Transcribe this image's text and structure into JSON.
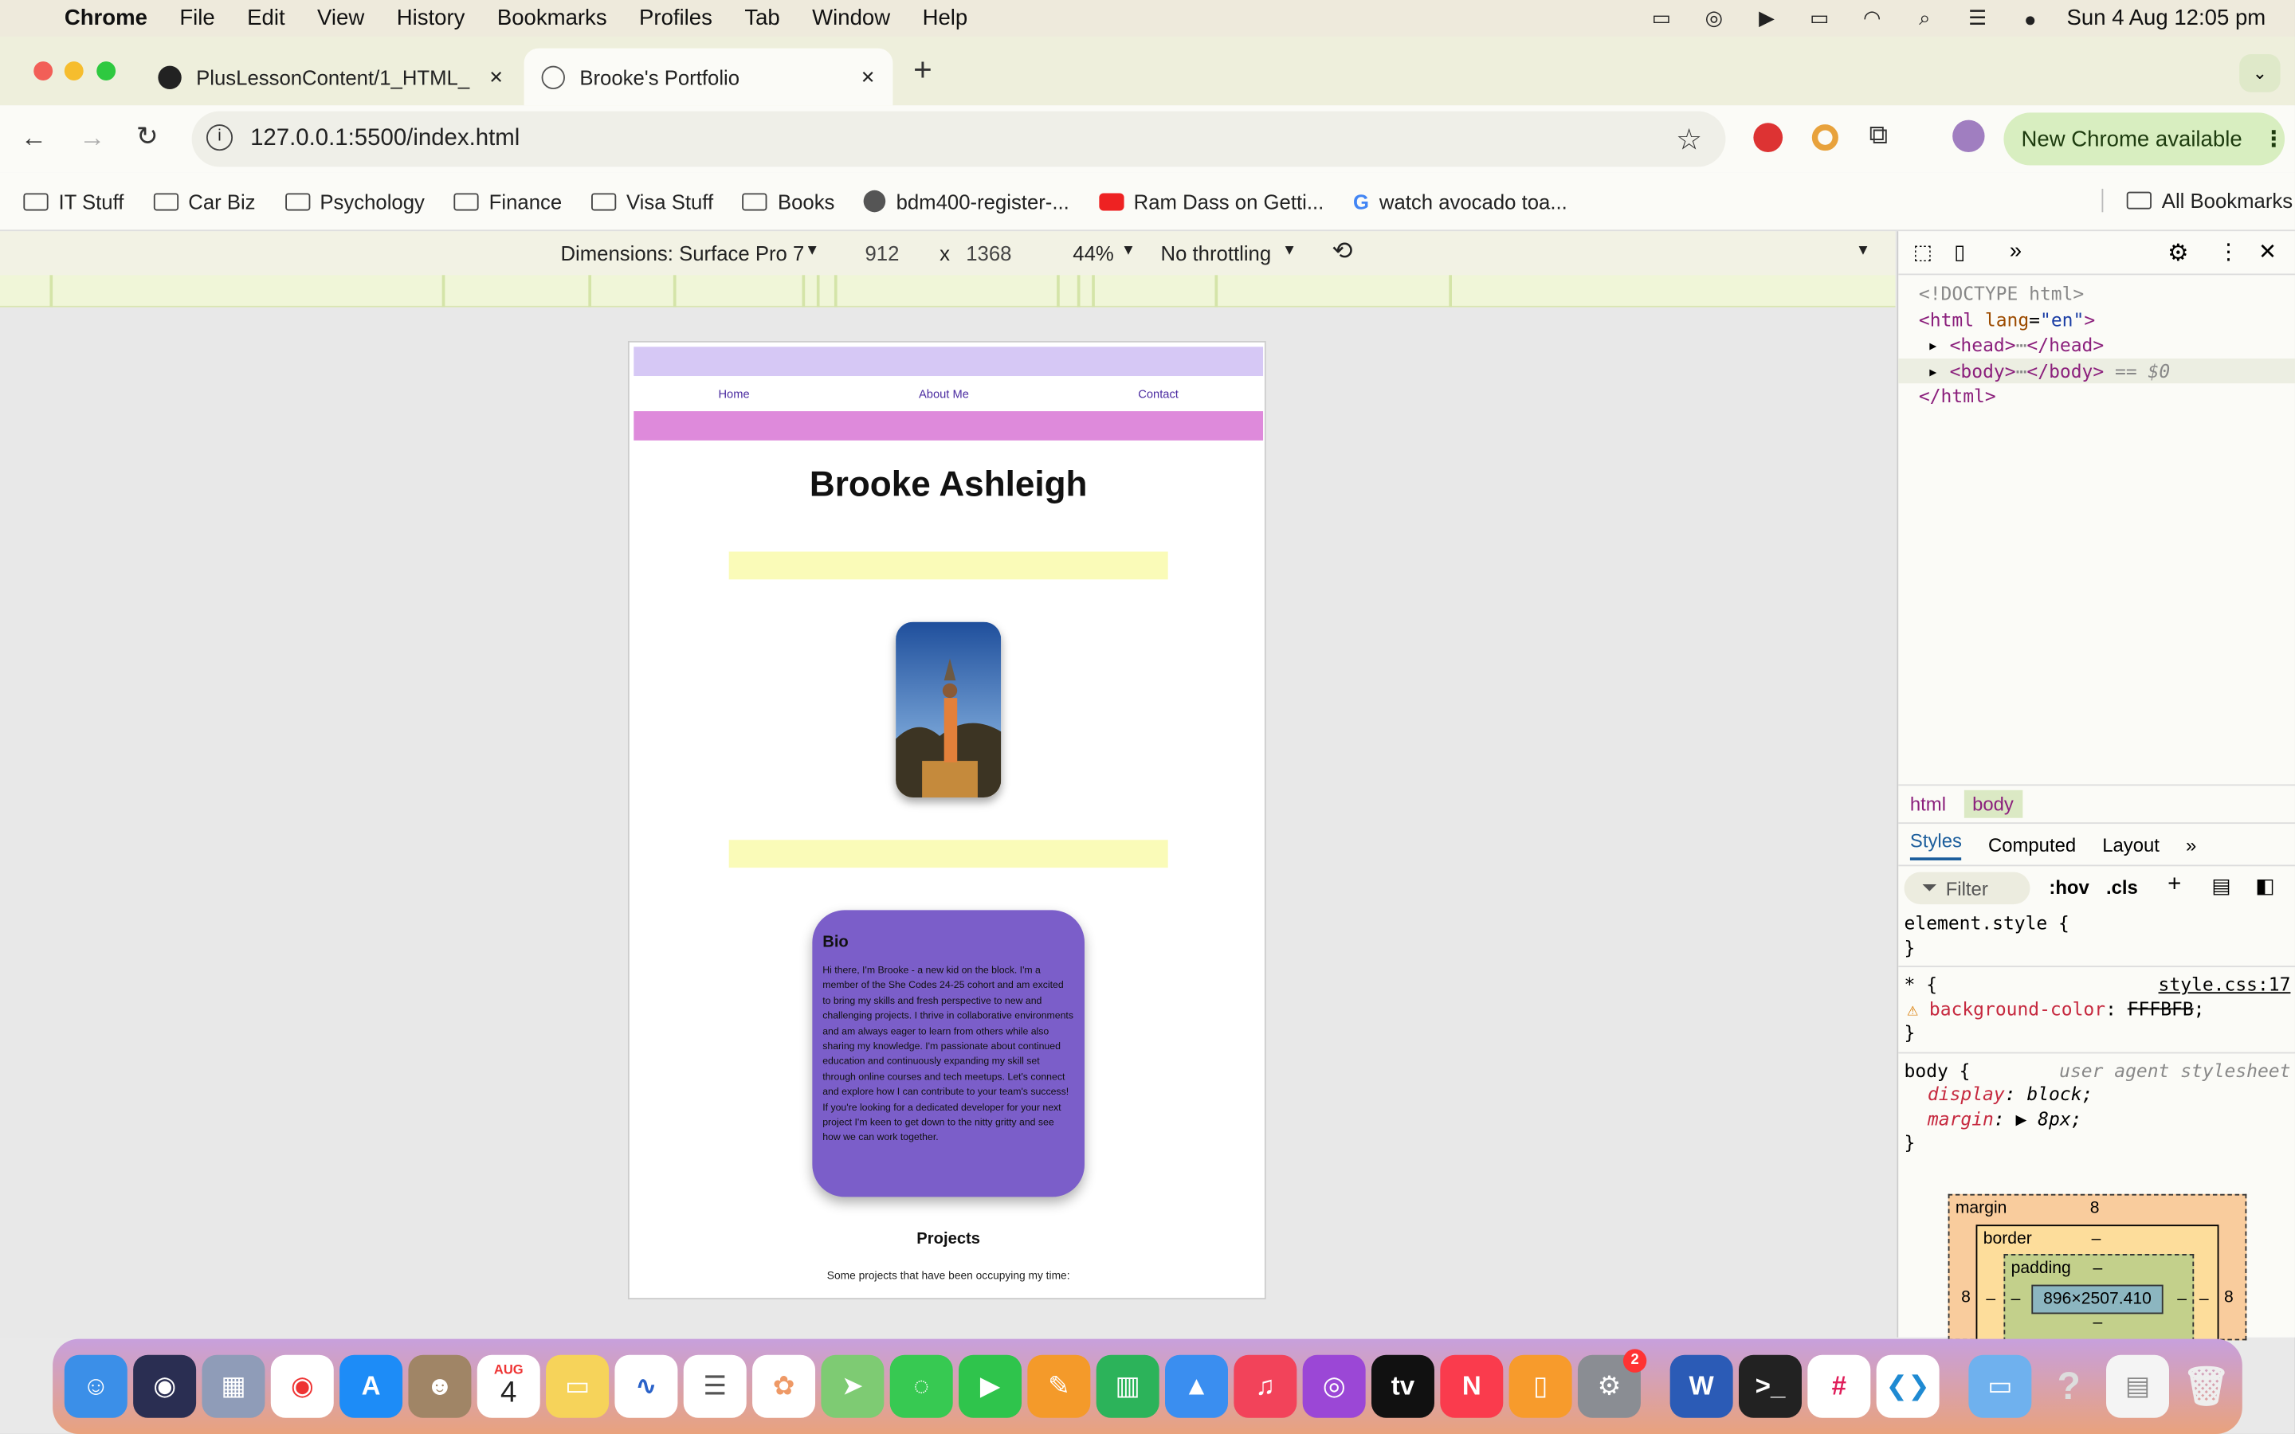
{
  "menubar": {
    "app": "Chrome",
    "items": [
      "File",
      "Edit",
      "View",
      "History",
      "Bookmarks",
      "Profiles",
      "Tab",
      "Window",
      "Help"
    ],
    "datetime": "Sun 4 Aug  12:05 pm"
  },
  "tabs": [
    {
      "title": "PlusLessonContent/1_HTML_",
      "close": "✕"
    },
    {
      "title": "Brooke's Portfolio",
      "close": "✕"
    }
  ],
  "new_tab": "+",
  "address": {
    "url": "127.0.0.1:5500/index.html"
  },
  "new_chrome": "New Chrome available",
  "bookmarks": [
    {
      "label": "IT Stuff",
      "icon": "folder-icon"
    },
    {
      "label": "Car Biz",
      "icon": "folder-icon"
    },
    {
      "label": "Psychology",
      "icon": "folder-icon"
    },
    {
      "label": "Finance",
      "icon": "folder-icon"
    },
    {
      "label": "Visa Stuff",
      "icon": "folder-icon"
    },
    {
      "label": "Books",
      "icon": "folder-icon"
    },
    {
      "label": "bdm400-register-...",
      "icon": "globe-icon"
    },
    {
      "label": "Ram Dass on Getti...",
      "icon": "youtube-icon"
    },
    {
      "label": "watch avocado toa...",
      "icon": "google-icon"
    }
  ],
  "all_bookmarks": "All Bookmarks",
  "device": {
    "dimensions": "Dimensions: Surface Pro 7",
    "width": "912",
    "height": "1368",
    "times": "x",
    "zoom": "44%",
    "throttling": "No throttling"
  },
  "site": {
    "nav": [
      "Home",
      "About Me",
      "Contact"
    ],
    "name": "Brooke Ashleigh",
    "bio_title": "Bio",
    "bio_text": "Hi there, I'm Brooke - a new kid on the block. I'm a member of the She Codes 24-25 cohort and am excited to bring my skills and fresh perspective to new and challenging projects. I thrive in collaborative environments and am always eager to learn from others while also sharing my knowledge. I'm passionate about continued education and continuously expanding my skill set through online courses and tech meetups. Let's connect and explore how I can contribute to your team's success! If you're looking for a dedicated developer for your next project I'm keen to get down to the nitty gritty and see how we can work together.",
    "projects_title": "Projects",
    "projects_sub": "Some projects that have been occupying my time:"
  },
  "devtools": {
    "doctype": "<!DOCTYPE html>",
    "html_open_tag": "html",
    "lang_attr": "lang",
    "lang_val": "\"en\"",
    "head_tag": "head",
    "body_tag": "body",
    "selected_marker": "== $0",
    "html_close": "</html>",
    "breadcrumbs": [
      "html",
      "body"
    ],
    "panel_tabs": [
      "Styles",
      "Computed",
      "Layout"
    ],
    "filter": "Filter",
    "hov": ":hov",
    "cls": ".cls",
    "element_style": "element.style {",
    "rule1_selector": "* {",
    "rule1_source": "style.css:17",
    "rule1_prop": "background-color",
    "rule1_val": "FFFBFB",
    "rule2_selector": "body {",
    "rule2_source": "user agent stylesheet",
    "rule2_props": [
      {
        "name": "display",
        "value": "block;"
      },
      {
        "name": "margin",
        "value": "▶ 8px;"
      }
    ],
    "close_brace": "}",
    "boxmodel": {
      "margin_label": "margin",
      "margin": "8",
      "border_label": "border",
      "border": "–",
      "padding_label": "padding",
      "padding": "–",
      "content": "896×2507.410",
      "side": "–"
    }
  },
  "dock": {
    "calendar_month": "AUG",
    "calendar_day": "4",
    "settings_badge": "2"
  }
}
